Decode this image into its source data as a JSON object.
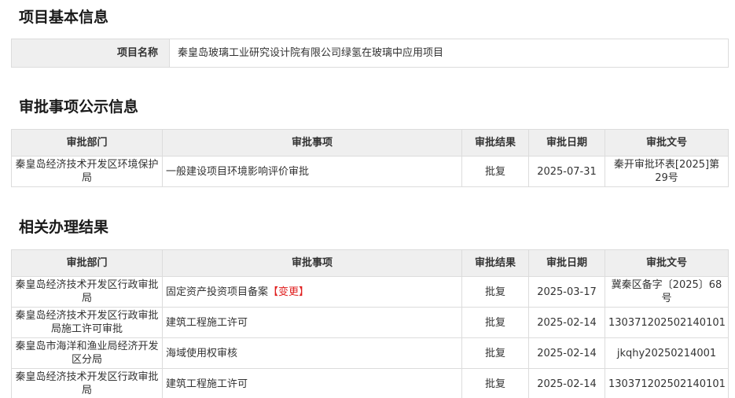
{
  "section1": {
    "title": "项目基本信息",
    "label": "项目名称",
    "value": "秦皇岛玻璃工业研究设计院有限公司绿氢在玻璃中应用项目"
  },
  "section2": {
    "title": "审批事项公示信息",
    "headers": [
      "审批部门",
      "审批事项",
      "审批结果",
      "审批日期",
      "审批文号"
    ],
    "rows": [
      {
        "dept": "秦皇岛经济技术开发区环境保护局",
        "item": "一般建设项目环境影响评价审批",
        "result": "批复",
        "date": "2025-07-31",
        "doc": "秦开审批环表[2025]第29号"
      }
    ]
  },
  "section3": {
    "title": "相关办理结果",
    "headers": [
      "审批部门",
      "审批事项",
      "审批结果",
      "审批日期",
      "审批文号"
    ],
    "rows": [
      {
        "dept": "秦皇岛经济技术开发区行政审批局",
        "item": "固定资产投资项目备案",
        "tag": "【变更】",
        "result": "批复",
        "date": "2025-03-17",
        "doc": "冀秦区备字〔2025〕68号"
      },
      {
        "dept": "秦皇岛经济技术开发区行政审批局施工许可审批",
        "item": "建筑工程施工许可",
        "result": "批复",
        "date": "2025-02-14",
        "doc": "130371202502140101"
      },
      {
        "dept": "秦皇岛市海洋和渔业局经济开发区分局",
        "item": "海域使用权审核",
        "result": "批复",
        "date": "2025-02-14",
        "doc": "jkqhy20250214001"
      },
      {
        "dept": "秦皇岛经济技术开发区行政审批局",
        "item": "建筑工程施工许可",
        "result": "批复",
        "date": "2025-02-14",
        "doc": "130371202502140101"
      }
    ]
  },
  "colors": {
    "header_bg": "#efefef",
    "border": "#dcdcdc",
    "change_tag": "#e02020"
  }
}
